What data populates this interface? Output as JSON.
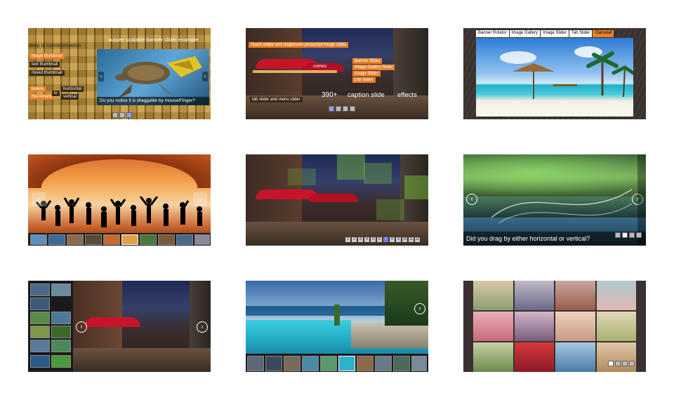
{
  "tile1": {
    "top_left_label": "deep ui cornstomization",
    "title": "supper scalable banner slider example",
    "buttons": [
      "image thumbnail",
      "text thumbnail",
      "mixed thumbnail"
    ],
    "bullets": "bullets",
    "thumbnails": "thumbnails",
    "in": "in",
    "horizontal": "horizontal",
    "vertical": "vertical",
    "caption": "Do you notice it is draggable by mouse/Finger?"
  },
  "tile2": {
    "top_caption": "Touch swipe and responsive javascript image slider",
    "comes": "comes",
    "list": [
      "Banner Slider",
      "Image Gallery Slider",
      "Image Slider",
      "Lite Slider"
    ],
    "big_390": "390+",
    "caption_slide": "caption slide",
    "effects": "effects",
    "bottom_caption": "tab slider and menu slider"
  },
  "tile3": {
    "tabs": [
      "Banner Rotator",
      "Image Gallery",
      "Image Slider",
      "Tab Slider",
      "Carousel"
    ],
    "active_tab": 4
  },
  "tile4": {
    "arrow_left": "‹",
    "arrow_right": "›"
  },
  "tile5": {
    "pages": [
      "1",
      "2",
      "3",
      "4",
      "5",
      "6",
      "7",
      "8",
      "9",
      "10",
      "11",
      "12"
    ],
    "active_page": 6
  },
  "tile6": {
    "caption": "Did you drag by either horizontal or vertical?",
    "arrow_left": "‹",
    "arrow_right": "›"
  },
  "tile7": {
    "arrow_left": "‹",
    "arrow_right": "›"
  },
  "tile8": {
    "arrow_right": "›"
  },
  "colors": {
    "accent_orange": "#e8822a",
    "dark_bar": "#1a1a1a"
  }
}
